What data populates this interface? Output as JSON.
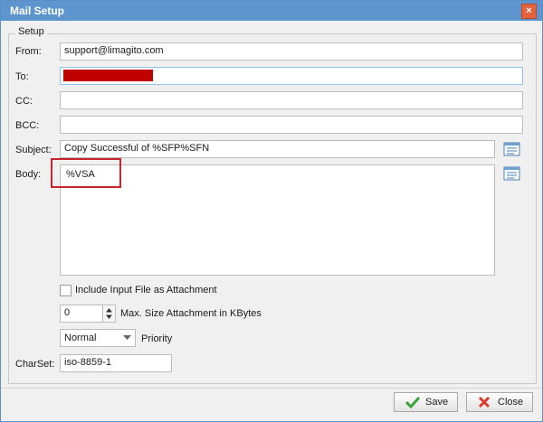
{
  "window": {
    "title": "Mail Setup"
  },
  "setup": {
    "group_title": "Setup",
    "from": {
      "label": "From:",
      "value": "support@limagito.com"
    },
    "to": {
      "label": "To:",
      "value": ""
    },
    "cc": {
      "label": "CC:",
      "value": ""
    },
    "bcc": {
      "label": "BCC:",
      "value": ""
    },
    "subject": {
      "label": "Subject:",
      "value": "Copy Successful of %SFP%SFN"
    },
    "body": {
      "label": "Body:",
      "value": "%VSA"
    },
    "include_attachment": {
      "label": "Include Input File as Attachment",
      "checked": false
    },
    "max_size": {
      "value": "0",
      "label": "Max. Size Attachment in KBytes"
    },
    "priority": {
      "value": "Normal",
      "label": "Priority"
    },
    "charset": {
      "label": "CharSet:",
      "value": "iso-8859-1"
    }
  },
  "buttons": {
    "save": "Save",
    "close": "Close"
  },
  "colors": {
    "titlebar": "#5e95cf",
    "highlight_border": "#c4262b",
    "redaction": "#c00000"
  },
  "icons": {
    "close": "close-icon",
    "subject_editor": "list-editor-icon",
    "body_editor": "list-editor-icon",
    "save": "checkmark-icon",
    "close_button": "x-icon"
  }
}
